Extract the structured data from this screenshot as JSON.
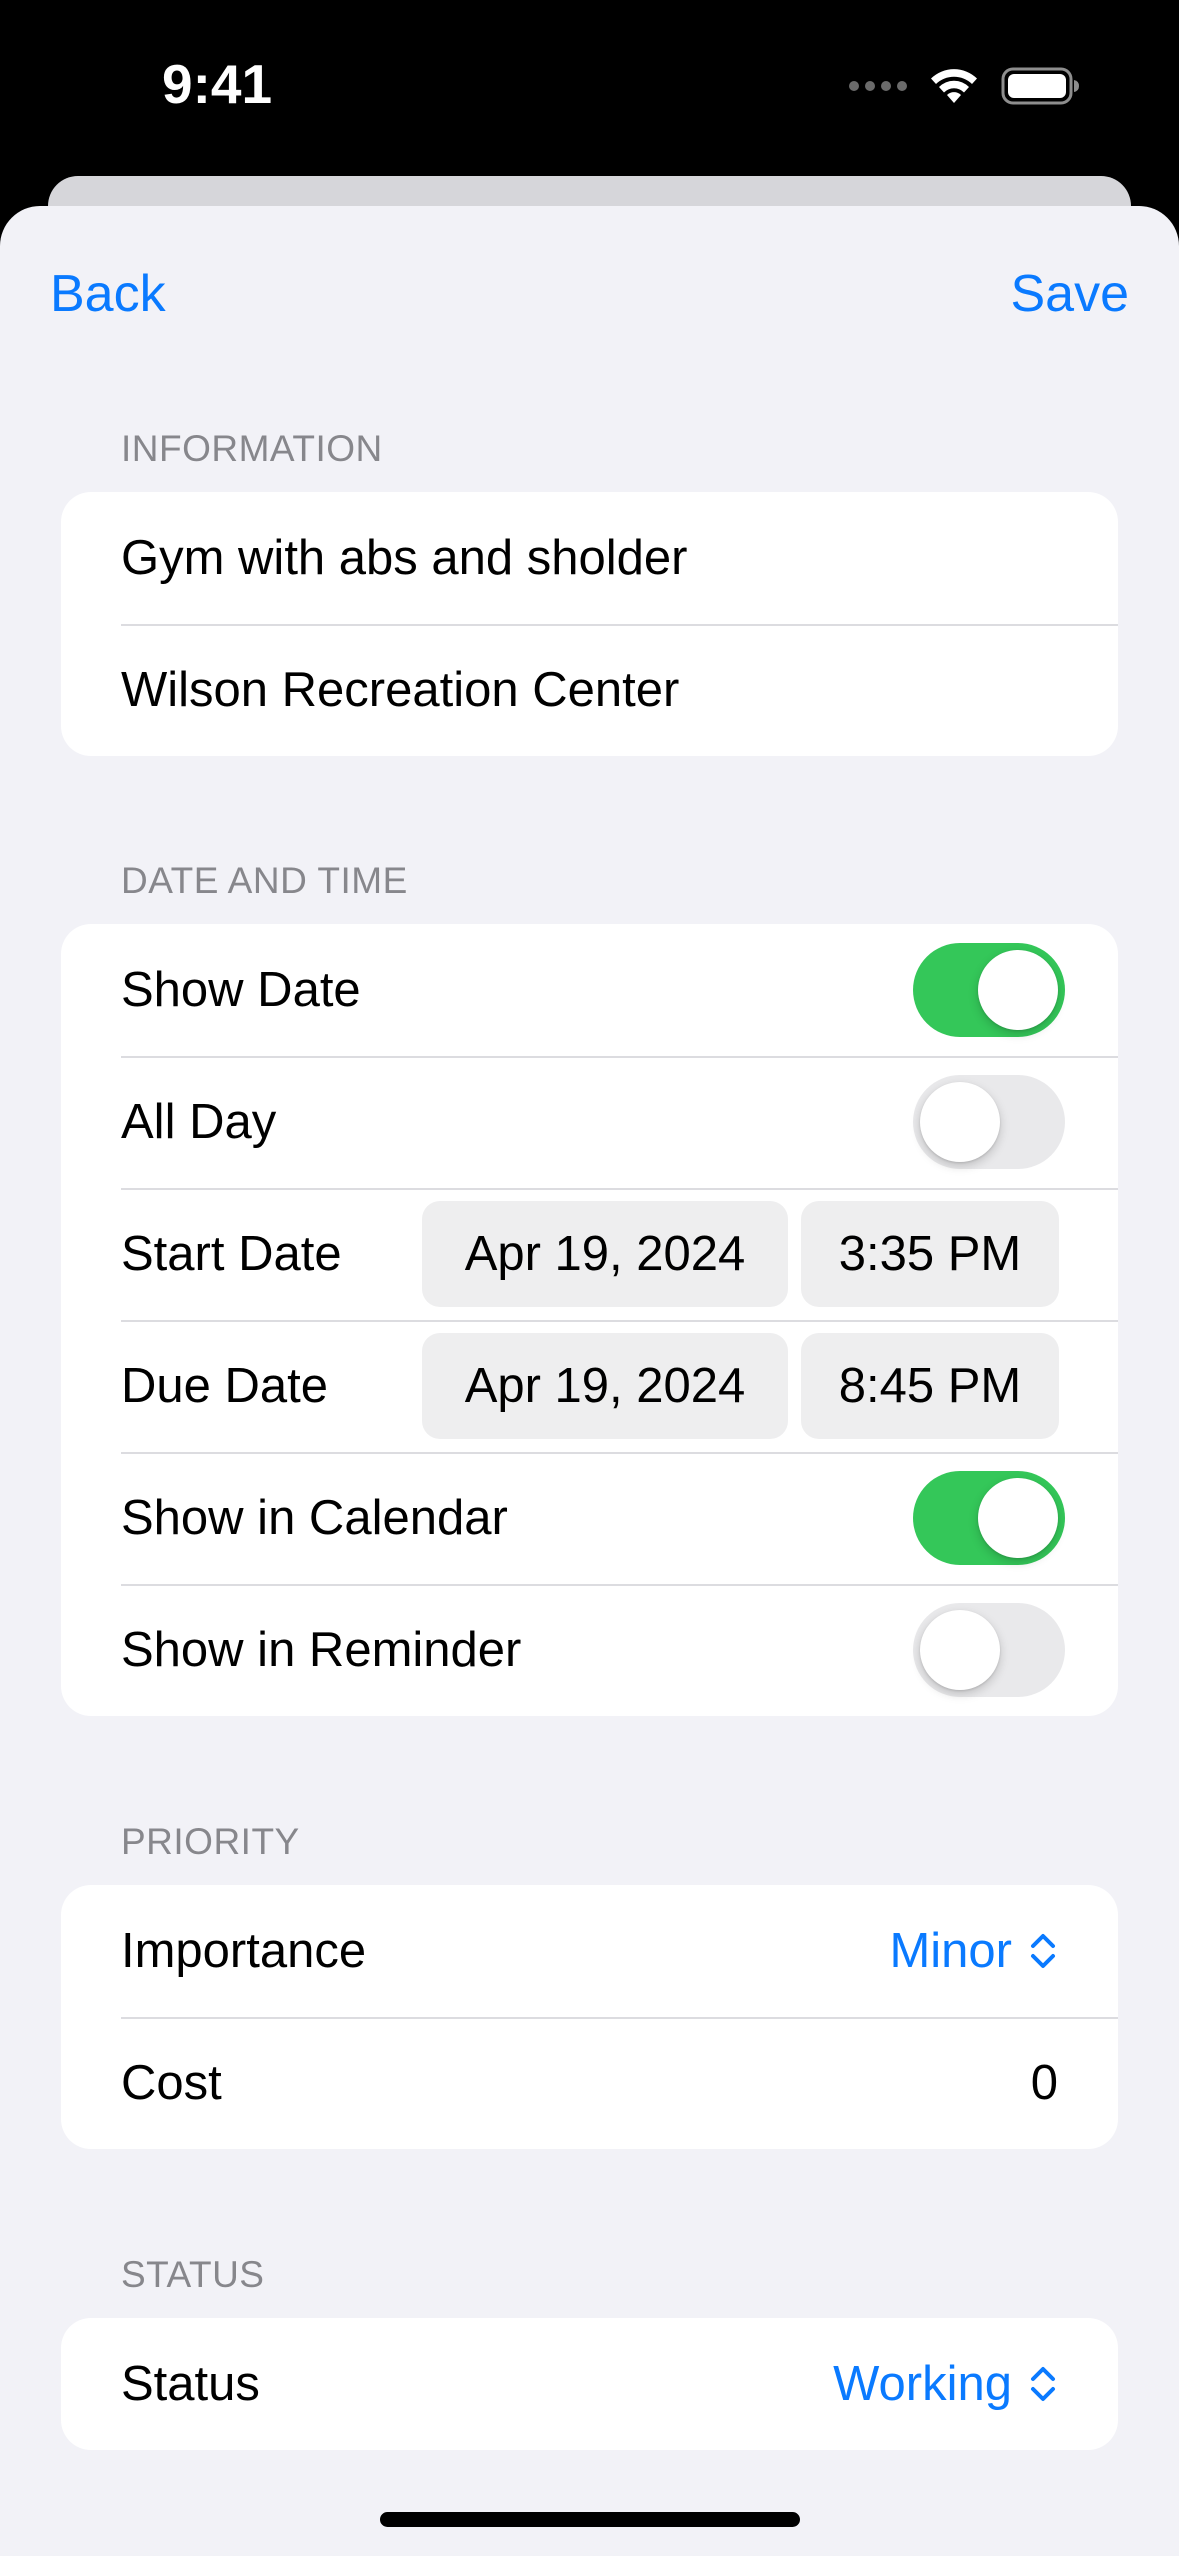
{
  "status_bar": {
    "time": "9:41"
  },
  "nav": {
    "back_label": "Back",
    "save_label": "Save"
  },
  "information": {
    "header": "INFORMATION",
    "title_value": "Gym with abs and sholder",
    "location_value": "Wilson Recreation Center"
  },
  "date_time": {
    "header": "DATE AND TIME",
    "show_date": {
      "label": "Show Date",
      "on": true
    },
    "all_day": {
      "label": "All Day",
      "on": false
    },
    "start": {
      "label": "Start Date",
      "date": "Apr 19, 2024",
      "time": "3:35 PM"
    },
    "due": {
      "label": "Due Date",
      "date": "Apr 19, 2024",
      "time": "8:45 PM"
    },
    "show_in_calendar": {
      "label": "Show in Calendar",
      "on": true
    },
    "show_in_reminder": {
      "label": "Show in Reminder",
      "on": false
    }
  },
  "priority": {
    "header": "PRIORITY",
    "importance": {
      "label": "Importance",
      "value": "Minor"
    },
    "cost": {
      "label": "Cost",
      "value": "0"
    }
  },
  "status": {
    "header": "STATUS",
    "status": {
      "label": "Status",
      "value": "Working"
    }
  },
  "colors": {
    "accent": "#0a7aff",
    "toggle_on": "#34c759",
    "toggle_off": "#e9e9eb",
    "background": "#f2f2f7"
  },
  "icons": [
    "wifi-icon",
    "battery-icon",
    "signal-dots-icon",
    "chevron-up-down-icon"
  ]
}
